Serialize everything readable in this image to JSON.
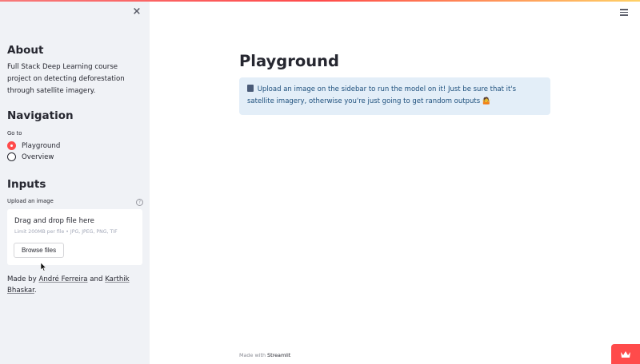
{
  "sidebar": {
    "close_icon": "×",
    "about": {
      "heading": "About",
      "text": "Full Stack Deep Learning course project on detecting deforestation through satellite imagery."
    },
    "navigation": {
      "heading": "Navigation",
      "label": "Go to",
      "options": [
        "Playground",
        "Overview"
      ],
      "selected": "Playground"
    },
    "inputs": {
      "heading": "Inputs",
      "upload_label": "Upload an image",
      "help_icon": "?",
      "dropzone_title": "Drag and drop file here",
      "dropzone_limit": "Limit 200MB per file • JPG, JPEG, PNG, TIF",
      "browse_label": "Browse files"
    },
    "credits": {
      "prefix": "Made by ",
      "author1": "André Ferreira",
      "middle": " and ",
      "author2": "Karthik Bhaskar",
      "suffix": "."
    }
  },
  "main": {
    "title": "Playground",
    "info_message": "Upload an image on the sidebar to run the model on it! Just be sure that it's satellite imagery, otherwise you're just going to get random outputs 🤷"
  },
  "footer": {
    "prefix": "Made with ",
    "brand": "Streamlit"
  },
  "colors": {
    "accent": "#ff4b4b",
    "sidebar_bg": "#f0f2f6",
    "info_bg": "#e3eef8",
    "info_text": "#1d4f7c",
    "text": "#262730"
  },
  "icons": {
    "close": "close-icon",
    "menu": "hamburger-menu-icon",
    "help": "help-icon",
    "info": "book-icon",
    "streamlit": "crown-icon"
  }
}
